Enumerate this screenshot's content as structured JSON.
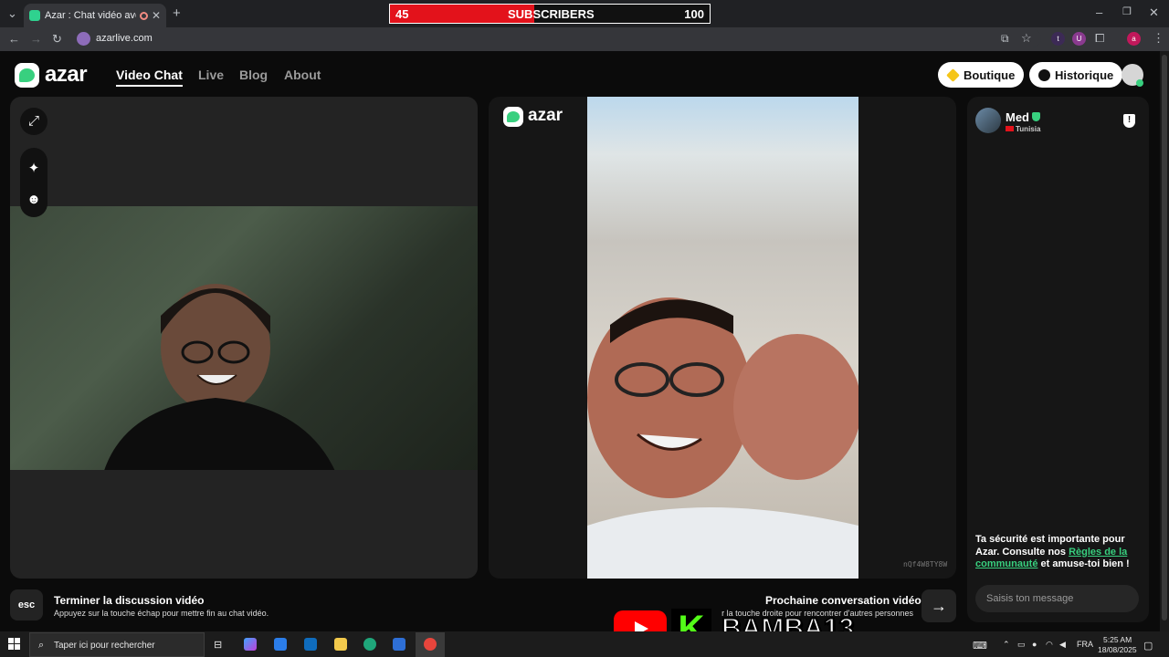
{
  "browser": {
    "tab_title": "Azar : Chat vidéo avec de n",
    "url": "azarlive.com",
    "site_initial": "",
    "extension_labels": [
      "t",
      "U",
      "a"
    ]
  },
  "overlay": {
    "subscribers_current": "45",
    "subscribers_label": "SUBSCRIBERS",
    "subscribers_goal": "100",
    "progress_fraction": 0.45,
    "progress_color": "#e3121b",
    "kick_letter": "K",
    "channel_name": "BAMBA13"
  },
  "app": {
    "logo_text": "azar",
    "nav": [
      "Video Chat",
      "Live",
      "Blog",
      "About"
    ],
    "active_nav": "Video Chat",
    "boutique_label": "Boutique",
    "history_label": "Historique",
    "accent_color": "#38d07f"
  },
  "remote": {
    "watermark_text": "azar",
    "session_code": "nQf4W8TY8W"
  },
  "chat": {
    "peer_name": "Med",
    "peer_country": "Tunisia",
    "safety_pre": "Ta sécurité est importante pour Azar. Consulte nos ",
    "safety_link": "Règles de la communauté",
    "safety_post": " et amuse-toi bien !",
    "input_placeholder": "Saisis ton message"
  },
  "bottom": {
    "esc_key": "esc",
    "end_title": "Terminer la discussion vidéo",
    "end_desc": "Appuyez sur la touche échap pour mettre fin au chat vidéo.",
    "next_title": "Prochaine conversation vidéo",
    "next_desc": "r la touche droite pour rencontrer d'autres personnes"
  },
  "taskbar": {
    "search_placeholder": "Taper ici pour rechercher",
    "language": "FRA",
    "time": "5:25 AM",
    "date": "18/08/2025"
  }
}
